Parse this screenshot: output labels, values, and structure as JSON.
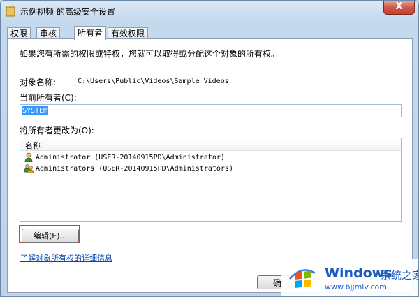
{
  "window": {
    "title": "示例视频 的高级安全设置",
    "close_label": "X"
  },
  "tabs": [
    {
      "label": "权限",
      "active": false
    },
    {
      "label": "审核",
      "active": false
    },
    {
      "label": "所有者",
      "active": true
    },
    {
      "label": "有效权限",
      "active": false
    }
  ],
  "owner_page": {
    "intro": "如果您有所需的权限或特权，您就可以取得或分配这个对象的所有权。",
    "object_name_label": "对象名称:",
    "object_name_value": "C:\\Users\\Public\\Videos\\Sample Videos",
    "current_owner_label": "当前所有者(C):",
    "current_owner_value": "SYSTEM",
    "change_owner_label": "将所有者更改为(O):",
    "list_header": "名称",
    "owners": [
      {
        "name": "Administrator (USER-20140915PD\\Administrator)",
        "icon": "user-icon"
      },
      {
        "name": "Administrators (USER-20140915PD\\Administrators)",
        "icon": "group-icon"
      }
    ],
    "edit_button": "编辑(E)...",
    "learn_more_link": "了解对象所有权的详细信息",
    "ok_button": "确"
  },
  "watermark": {
    "brand": "Windows",
    "brand_cn": "系统之家",
    "url": "www.bjjmlv.com"
  },
  "colors": {
    "highlight_border": "#e23a2e",
    "selection": "#3399ff",
    "link": "#0645ad",
    "close_button": "#c2412f"
  }
}
